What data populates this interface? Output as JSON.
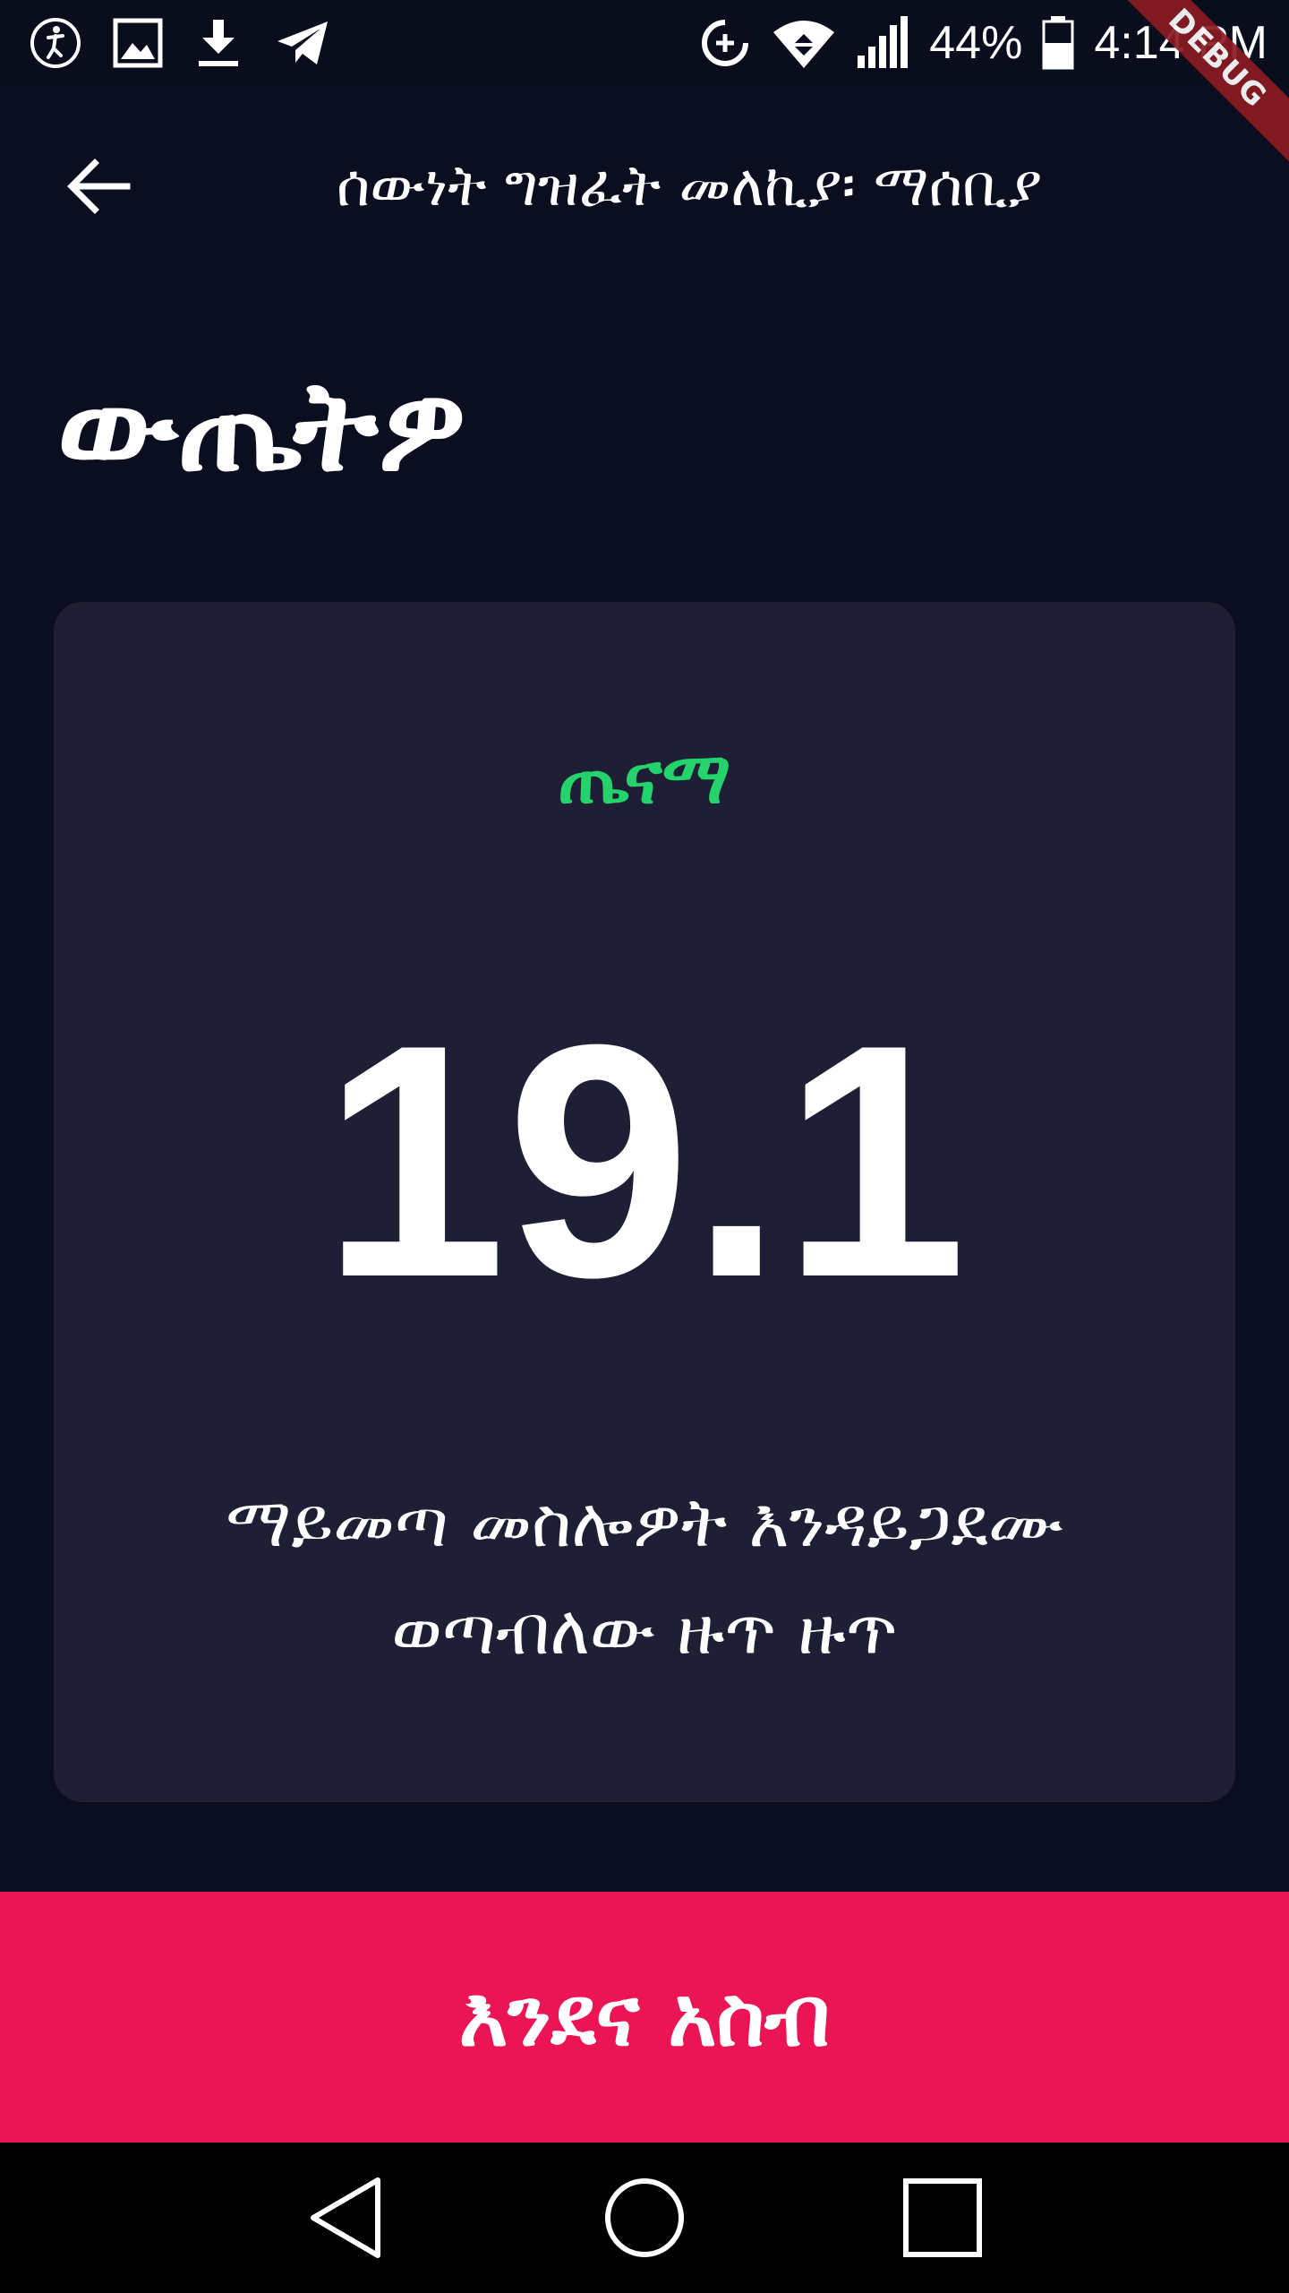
{
  "status_bar": {
    "battery_percent": "44%",
    "time": "4:14 PM",
    "left_icons": [
      "accessibility-icon",
      "gallery-icon",
      "download-icon",
      "telegram-icon"
    ],
    "right_icons": [
      "data-saver-icon",
      "wifi-icon",
      "signal-icon",
      "battery-icon"
    ]
  },
  "debug_banner": "DEBUG",
  "app_bar": {
    "title": "ሰውነት ግዝፈት መለኪያ፡ ማሰቢያ",
    "back_icon": "arrow-left-icon"
  },
  "heading": "ውጤትዎ",
  "result": {
    "status": "ጤናማ",
    "status_color": "#24d36c",
    "value": "19.1",
    "message": "ማይመጣ መስሎዎት እንዳይጋደሙ ወጣብለው ዙጥ ዙጥ"
  },
  "recalculate_button": "እንደና አስብ",
  "colors": {
    "background": "#0b0e1f",
    "card": "#1e1f35",
    "accent": "#eb1555"
  },
  "nav_bar": {
    "icons": [
      "back-triangle-icon",
      "home-circle-icon",
      "recents-square-icon"
    ]
  }
}
